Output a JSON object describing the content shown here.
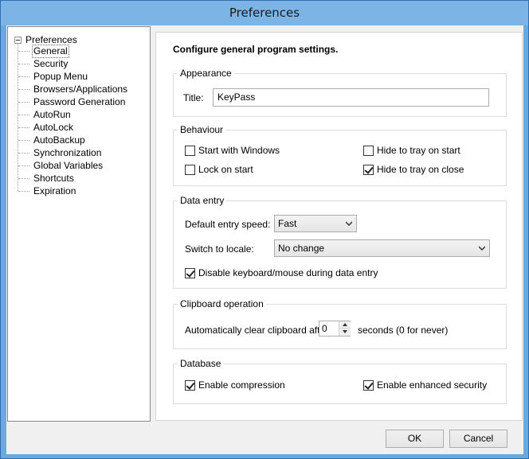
{
  "window": {
    "title": "Preferences"
  },
  "tree": {
    "root": "Preferences",
    "items": [
      {
        "label": "General",
        "selected": true
      },
      {
        "label": "Security"
      },
      {
        "label": "Popup Menu"
      },
      {
        "label": "Browsers/Applications"
      },
      {
        "label": "Password Generation"
      },
      {
        "label": "AutoRun"
      },
      {
        "label": "AutoLock"
      },
      {
        "label": "AutoBackup"
      },
      {
        "label": "Synchronization"
      },
      {
        "label": "Global Variables"
      },
      {
        "label": "Shortcuts"
      },
      {
        "label": "Expiration"
      }
    ]
  },
  "panel": {
    "heading": "Configure general program settings.",
    "appearance": {
      "group_title": "Appearance",
      "title_label": "Title:",
      "title_value": "KeyPass"
    },
    "behaviour": {
      "group_title": "Behaviour",
      "start_with_windows": {
        "label": "Start with Windows",
        "checked": false
      },
      "hide_tray_start": {
        "label": "Hide to tray on start",
        "checked": false
      },
      "lock_on_start": {
        "label": "Lock on start",
        "checked": false
      },
      "hide_tray_close": {
        "label": "Hide to tray on close",
        "checked": true
      }
    },
    "data_entry": {
      "group_title": "Data entry",
      "speed_label": "Default entry speed:",
      "speed_value": "Fast",
      "locale_label": "Switch to locale:",
      "locale_value": "No change",
      "disable_kbd": {
        "label": "Disable keyboard/mouse during data entry",
        "checked": true
      }
    },
    "clipboard": {
      "group_title": "Clipboard operation",
      "clear_label": "Automatically clear clipboard after",
      "clear_value": "0",
      "clear_suffix": "seconds (0 for never)"
    },
    "database": {
      "group_title": "Database",
      "compression": {
        "label": "Enable compression",
        "checked": true
      },
      "enhanced_security": {
        "label": "Enable enhanced security",
        "checked": true
      }
    }
  },
  "buttons": {
    "ok": "OK",
    "cancel": "Cancel"
  }
}
